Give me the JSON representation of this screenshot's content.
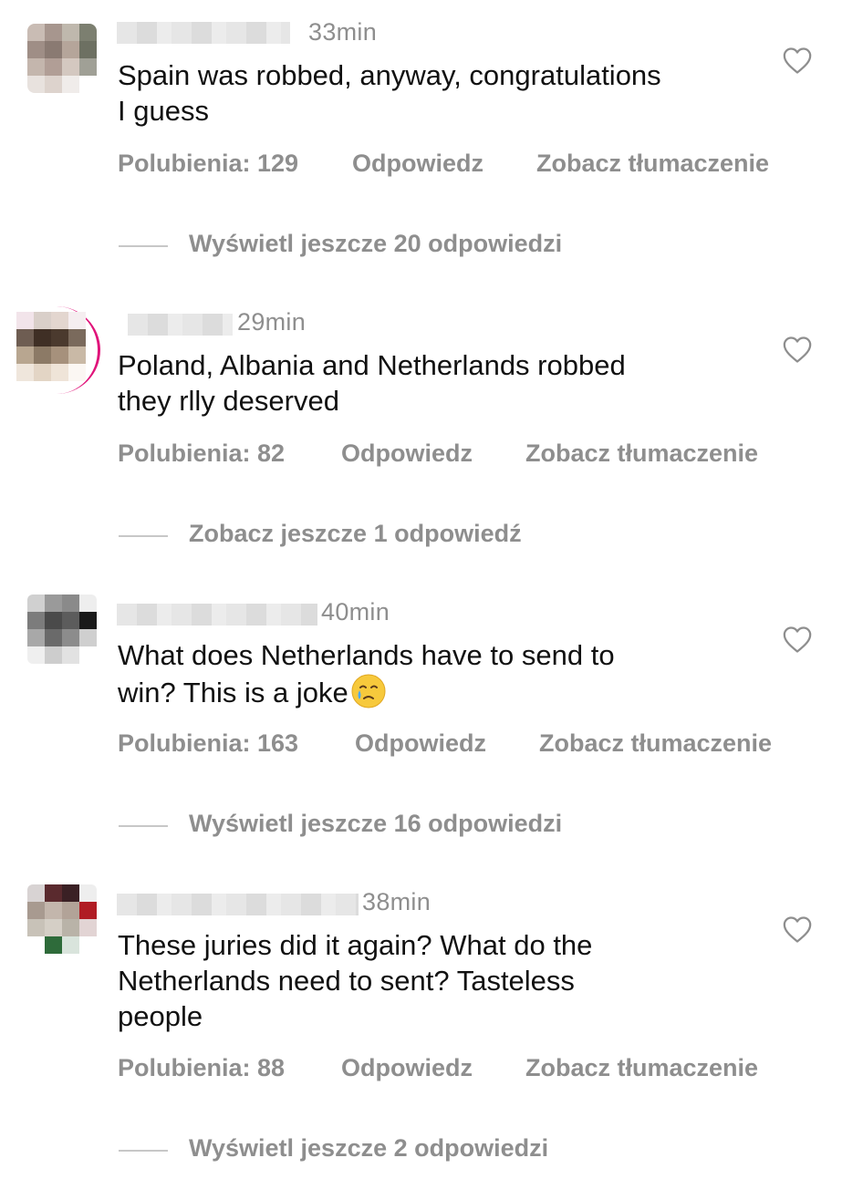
{
  "comments": [
    {
      "time": "33min",
      "text": "Spain was robbed, anyway, congratulations\nI guess",
      "likes": "Polubienia: 129",
      "reply": "Odpowiedz",
      "translate": "Zobacz tłumaczenie",
      "view_replies": "Wyświetl jeszcze 20 odpowiedzi"
    },
    {
      "time": "29min",
      "text": "Poland, Albania and Netherlands robbed\nthey rlly deserved",
      "likes": "Polubienia: 82",
      "reply": "Odpowiedz",
      "translate": "Zobacz tłumaczenie",
      "view_replies": "Zobacz jeszcze 1 odpowiedź"
    },
    {
      "time": "40min",
      "text": "What does Netherlands have to send to\nwin? This is a joke",
      "emoji": "face-holding-back-tears-icon",
      "likes": "Polubienia: 163",
      "reply": "Odpowiedz",
      "translate": "Zobacz tłumaczenie",
      "view_replies": "Wyświetl jeszcze 16 odpowiedzi"
    },
    {
      "time": "38min",
      "text": "These juries did it again? What do the\nNetherlands need to sent? Tasteless\npeople",
      "likes": "Polubienia: 88",
      "reply": "Odpowiedz",
      "translate": "Zobacz tłumaczenie",
      "view_replies": "Wyświetl jeszcze 2 odpowiedzi"
    }
  ],
  "icons": {
    "like": "heart-outline-icon",
    "avatar": "blurred-avatar"
  },
  "colors": {
    "secondary_text": "#8e8e8e",
    "story_ring": "#e0147a"
  }
}
